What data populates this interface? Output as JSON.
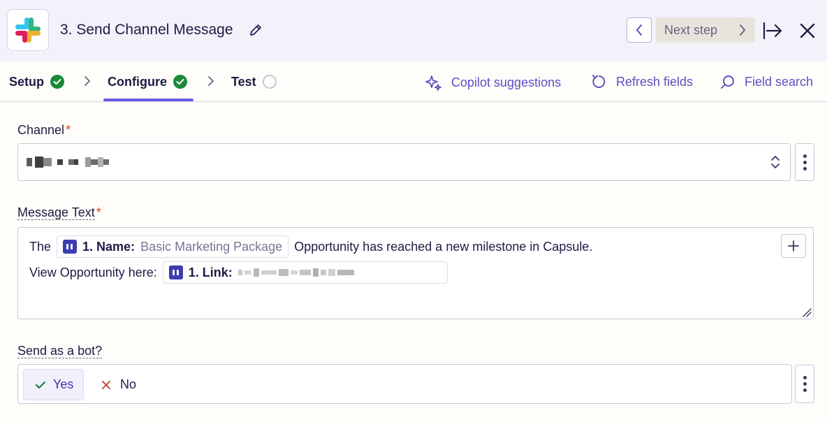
{
  "header": {
    "title": "3. Send Channel Message",
    "app_icon": "slack-logo",
    "next_step_label": "Next step"
  },
  "tabs": [
    {
      "label": "Setup",
      "status": "complete"
    },
    {
      "label": "Configure",
      "status": "complete",
      "active": true
    },
    {
      "label": "Test",
      "status": "pending"
    }
  ],
  "actions": {
    "copilot": "Copilot suggestions",
    "refresh": "Refresh fields",
    "search": "Field search"
  },
  "fields": {
    "channel": {
      "label": "Channel",
      "required": "*"
    },
    "message": {
      "label": "Message Text",
      "required": "*",
      "line1_prefix": "The",
      "name_pill_key": "1. Name:",
      "name_pill_value": "Basic Marketing Package",
      "line1_suffix": "Opportunity has reached a new milestone in Capsule.",
      "line2_prefix": "View Opportunity here:",
      "link_pill_key": "1. Link:"
    },
    "bot": {
      "label": "Send as a bot?",
      "yes_label": "Yes",
      "no_label": "No",
      "selected": "Yes"
    }
  },
  "colors": {
    "accent": "#695be8",
    "success": "#1a8a3a",
    "required": "#d5491d"
  }
}
